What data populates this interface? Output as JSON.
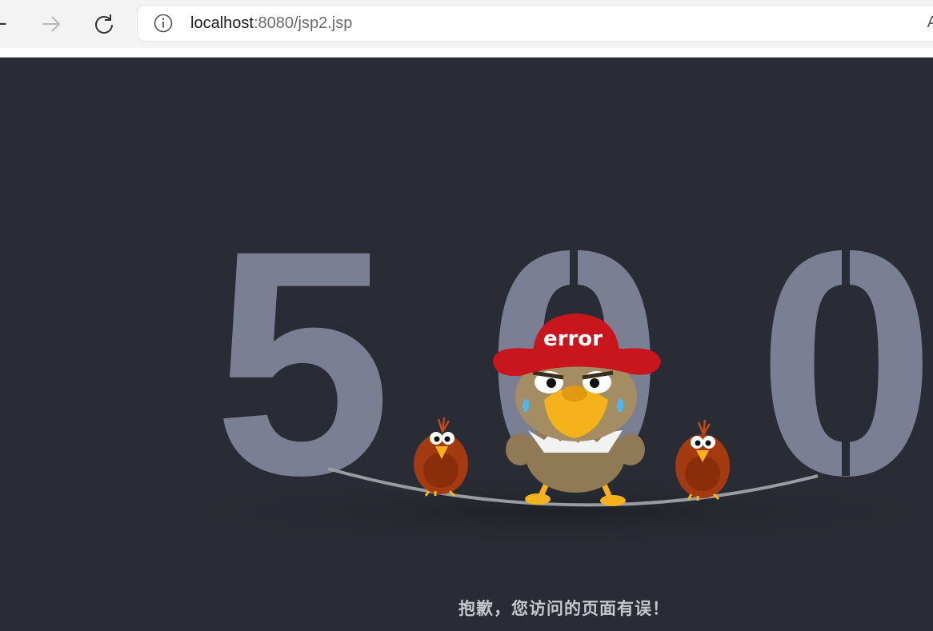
{
  "browser": {
    "url_host": "localhost",
    "url_rest": ":8080/jsp2.jsp",
    "back_glyph": "←",
    "forward_glyph": "→",
    "address_right_glyph": "A",
    "icons": [
      "back-icon",
      "forward-icon",
      "reload-icon",
      "info-icon"
    ]
  },
  "error_page": {
    "code_digits": [
      "5",
      "0",
      "0"
    ],
    "hat_text": "error",
    "message": "抱歉，您访问的页面有误！",
    "colors": {
      "background": "#2a2c35",
      "digits": "#7b7f93",
      "hat": "#c8161c",
      "message": "#c5c7cf"
    }
  }
}
